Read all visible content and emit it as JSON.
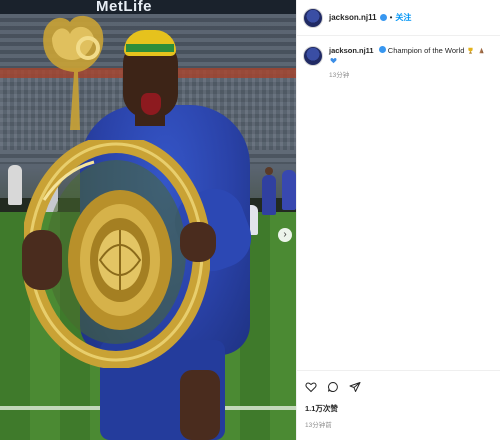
{
  "photo": {
    "sponsor_text": "MetLife",
    "alt_subject": "player-with-trophy"
  },
  "header": {
    "username": "jackson.nj11",
    "separator": "•",
    "follow_label": "关注"
  },
  "caption": {
    "username": "jackson.nj11",
    "text": "Champion of the World",
    "emojis": [
      "trophy-icon",
      "praying-hands-icon",
      "blue-heart-icon"
    ],
    "time": "13分钟"
  },
  "actions": {
    "likes": "1.1万次赞",
    "time": "13分钟前"
  },
  "colors": {
    "link": "#0095f6",
    "verified": "#3897f0",
    "kit": "#2a42a8",
    "trophy": "#c9a235"
  }
}
